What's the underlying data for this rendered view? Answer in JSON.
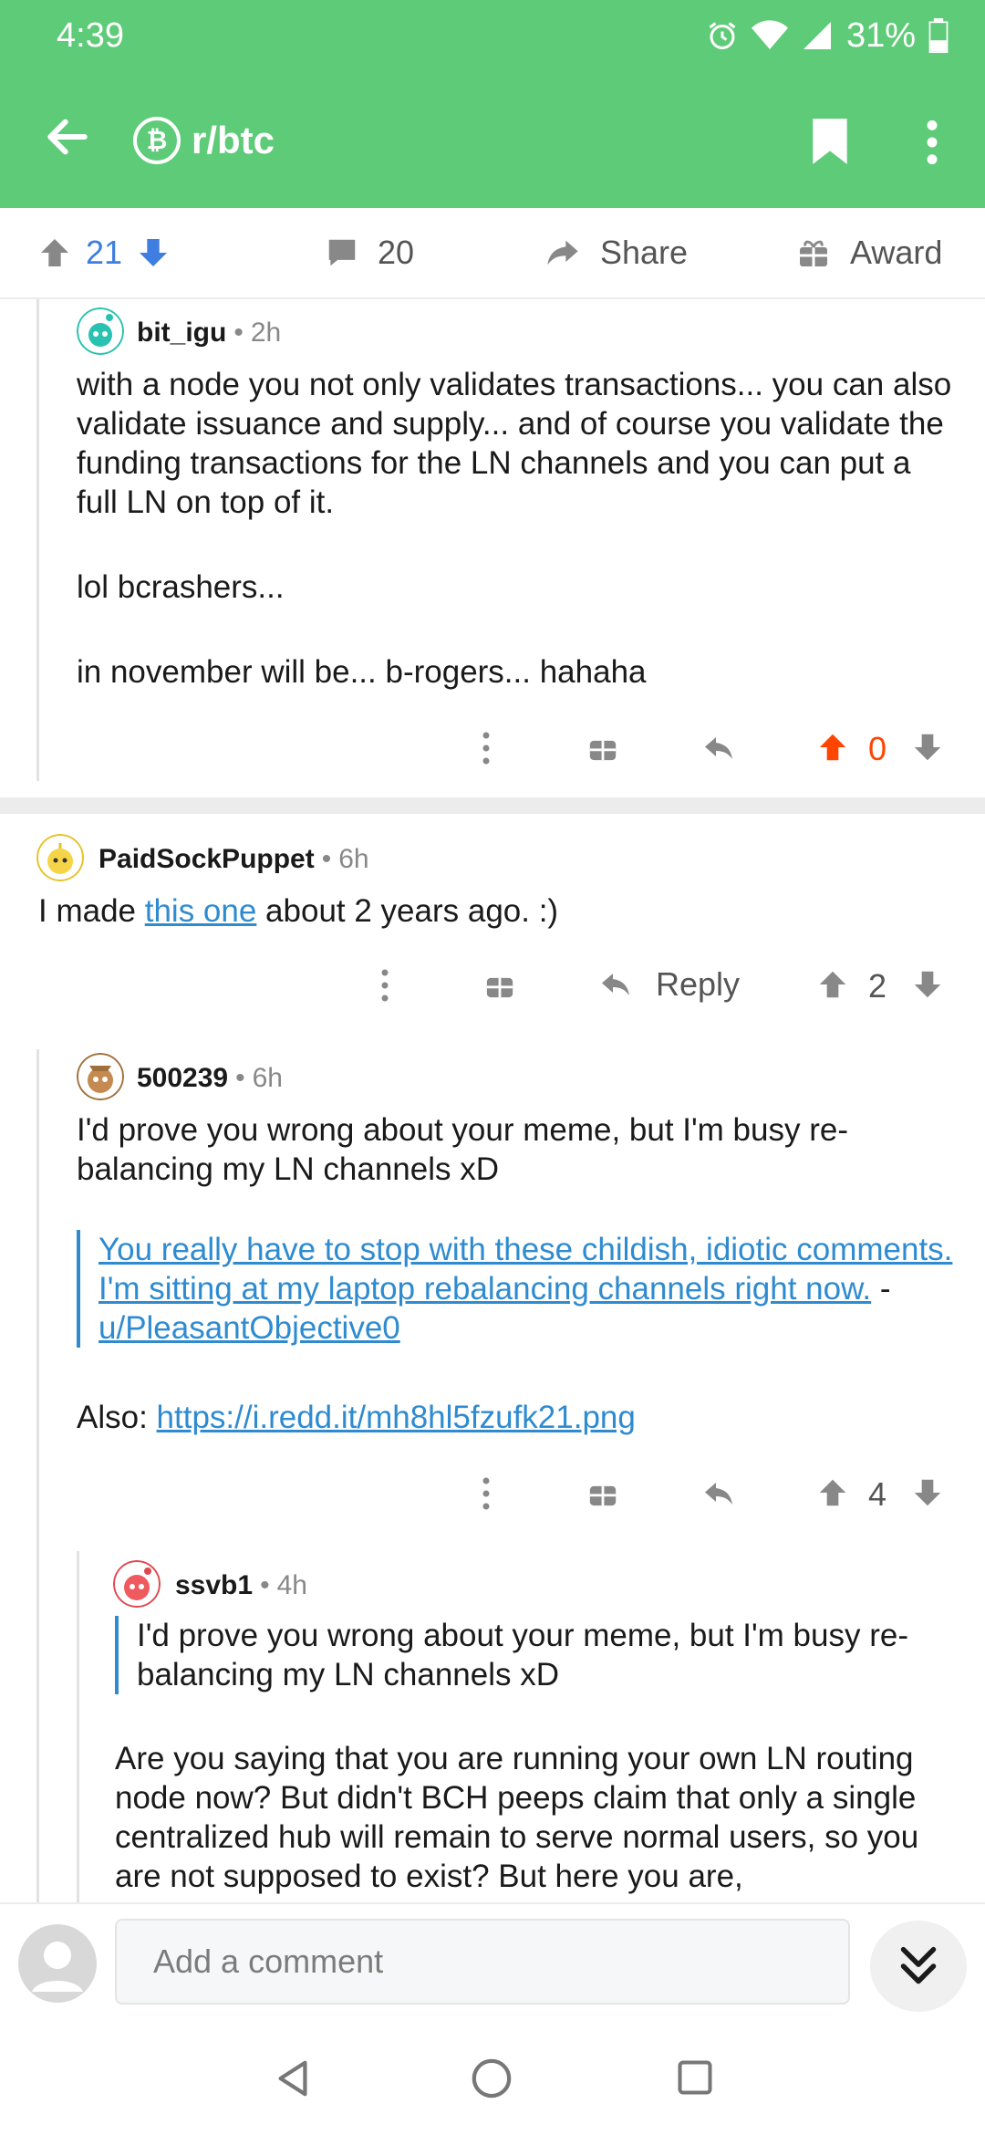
{
  "status_bar": {
    "time": "4:39",
    "battery": "31%"
  },
  "app_bar": {
    "subreddit": "r/btc",
    "sub_icon": "bitcoin-icon"
  },
  "action_bar": {
    "upvotes": "21",
    "comments": "20",
    "share": "Share",
    "award": "Award"
  },
  "comments": [
    {
      "user": "bit_igu",
      "sep": "•",
      "age": "2h",
      "paragraphs": [
        "with a node you not only validates transactions... you can also validate issuance and supply... and of course you validate the funding transactions for the LN channels and you can put a full LN on top of it.",
        "lol bcrashers...",
        "in november will be... b-rogers... hahaha"
      ],
      "score": "0"
    },
    {
      "user": "PaidSockPuppet",
      "sep": "•",
      "age": "6h",
      "text_before": "I made ",
      "link": "this one",
      "text_after": " about 2 years ago. :)",
      "reply_label": "Reply",
      "score": "2"
    },
    {
      "user": "500239",
      "sep": "•",
      "age": "6h",
      "text": "I'd prove you wrong about your meme, but I'm busy re-balancing my LN channels xD",
      "quote_link": "You really have to stop with these childish, idiotic comments. I'm sitting at my laptop rebalancing channels right now.",
      "quote_dash": " - ",
      "quote_user": "u/PleasantObjective0",
      "also_label": "Also: ",
      "also_link": "https://i.redd.it/mh8hl5fzufk21.png",
      "score": "4"
    },
    {
      "user": "ssvb1",
      "sep": "•",
      "age": "4h",
      "quote": "I'd prove you wrong about your meme, but I'm busy re-balancing my LN channels xD",
      "text": "Are you saying that you are running your own LN routing node now? But didn't BCH peeps claim that only a single centralized hub will remain to serve normal users, so you are not supposed to exist? But here you are,"
    }
  ],
  "bottom_bar": {
    "comment_placeholder": "Add a comment"
  },
  "colors": {
    "header": "#5ecb78",
    "upvote_active": "#ff4500",
    "link": "#2f8bd0",
    "vote_blue": "#3d7ee0"
  }
}
